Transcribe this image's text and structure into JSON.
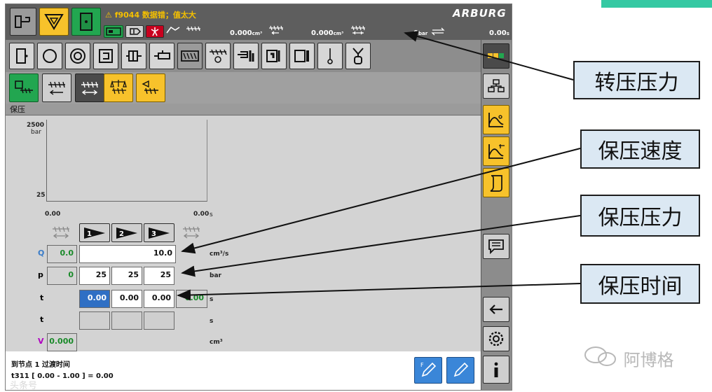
{
  "colors": {
    "accent_yellow": "#f7c22b",
    "accent_green": "#22a650",
    "selection_blue": "#2f6fc4",
    "callout_bg": "#dbe8f3",
    "teal_strip": "#35c9a3",
    "q_label": "#3a7cc8",
    "v_label": "#b000c0"
  },
  "statusbar": {
    "warning_text": "⚠ f9044 数据错；值太大",
    "logo": "ARBURG",
    "volume1": "0.000",
    "volume1_unit": "cm³",
    "volume2": "0.000",
    "volume2_unit": "cm³",
    "pressure": "0",
    "pressure_unit": "bar",
    "time": "0.00",
    "time_unit": "s"
  },
  "toolbar_icons": [
    "mold-icon",
    "cycle-icon",
    "rotation-icon",
    "ejector-icon",
    "core-pull-icon",
    "nozzle-icon",
    "injection-icon",
    "holding-pressure-icon",
    "dosing-icon",
    "temperature-icon",
    "cylinder-icon",
    "thermometer-icon",
    "robot-icon"
  ],
  "section": {
    "title": "保压"
  },
  "chart": {
    "y_max_label": "2500",
    "y_unit": "bar",
    "y_min_label": "25",
    "x_start": "0.00",
    "x_end": "0.00",
    "x_unit": "s"
  },
  "stages": [
    "1",
    "2",
    "3"
  ],
  "rows": {
    "q": {
      "label": "Q",
      "actual": "0.0",
      "value": "10.0",
      "unit": "cm³/s"
    },
    "p": {
      "label": "p",
      "actual": "0",
      "values": [
        "25",
        "25",
        "25"
      ],
      "unit": "bar"
    },
    "t": {
      "label": "t",
      "values": [
        "0.00",
        "0.00",
        "0.00"
      ],
      "actual": "0.00",
      "unit": "s"
    },
    "t2": {
      "label": "t",
      "unit": "s"
    },
    "v": {
      "label": "V",
      "actual": "0.000",
      "unit": "cm³"
    }
  },
  "bottom": {
    "line1": "到节点 1 过渡时间",
    "line2": "t311 [ 0.00 - 1.00 ] = 0.00"
  },
  "callouts": {
    "c1": "转压压力",
    "c2": "保压速度",
    "c3": "保压压力",
    "c4": "保压时间"
  },
  "watermark": {
    "right": "阿博格",
    "left": "头条号"
  }
}
